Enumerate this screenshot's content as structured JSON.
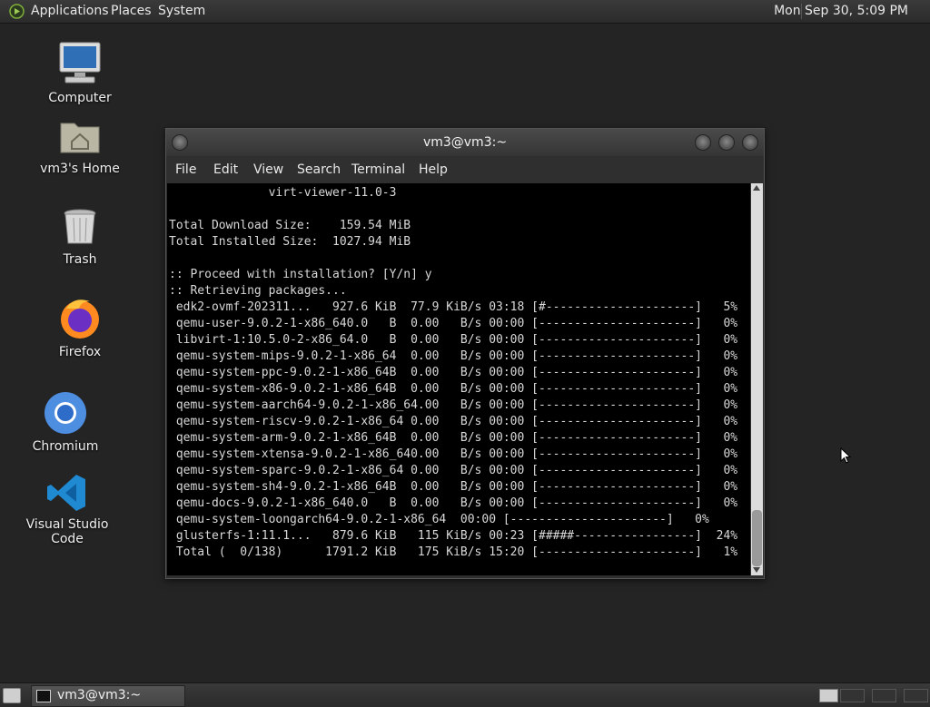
{
  "top_panel": {
    "applications": "Applications",
    "places": "Places",
    "system": "System",
    "clock": "Mon Sep 30,  5:09 PM"
  },
  "desktop": {
    "icons": [
      {
        "label": "Computer",
        "icon": "computer-icon"
      },
      {
        "label": "vm3's Home",
        "icon": "home-folder-icon"
      },
      {
        "label": "Trash",
        "icon": "trash-icon"
      },
      {
        "label": "Firefox",
        "icon": "firefox-icon"
      },
      {
        "label": "Chromium",
        "icon": "chromium-icon"
      },
      {
        "label": "Visual Studio Code",
        "icon": "vscode-icon"
      }
    ]
  },
  "terminal": {
    "title": "vm3@vm3:~",
    "menu": [
      "File",
      "Edit",
      "View",
      "Search",
      "Terminal",
      "Help"
    ],
    "lines": [
      "              virt-viewer-11.0-3",
      "",
      "Total Download Size:    159.54 MiB",
      "Total Installed Size:  1027.94 MiB",
      "",
      ":: Proceed with installation? [Y/n] y",
      ":: Retrieving packages...",
      " edk2-ovmf-202311...   927.6 KiB  77.9 KiB/s 03:18 [#---------------------]   5%",
      " qemu-user-9.0.2-1-x86_640.0   B  0.00   B/s 00:00 [----------------------]   0%",
      " libvirt-1:10.5.0-2-x86_64.0   B  0.00   B/s 00:00 [----------------------]   0%",
      " qemu-system-mips-9.0.2-1-x86_64  0.00   B/s 00:00 [----------------------]   0%",
      " qemu-system-ppc-9.0.2-1-x86_64B  0.00   B/s 00:00 [----------------------]   0%",
      " qemu-system-x86-9.0.2-1-x86_64B  0.00   B/s 00:00 [----------------------]   0%",
      " qemu-system-aarch64-9.0.2-1-x86_64.00   B/s 00:00 [----------------------]   0%",
      " qemu-system-riscv-9.0.2-1-x86_64 0.00   B/s 00:00 [----------------------]   0%",
      " qemu-system-arm-9.0.2-1-x86_64B  0.00   B/s 00:00 [----------------------]   0%",
      " qemu-system-xtensa-9.0.2-1-x86_640.00   B/s 00:00 [----------------------]   0%",
      " qemu-system-sparc-9.0.2-1-x86_64 0.00   B/s 00:00 [----------------------]   0%",
      " qemu-system-sh4-9.0.2-1-x86_64B  0.00   B/s 00:00 [----------------------]   0%",
      " qemu-docs-9.0.2-1-x86_640.0   B  0.00   B/s 00:00 [----------------------]   0%",
      " qemu-system-loongarch64-9.0.2-1-x86_64  00:00 [----------------------]   0%",
      " glusterfs-1:11.1...   879.6 KiB   115 KiB/s 00:23 [#####-----------------]  24%",
      " Total (  0/138)      1791.2 KiB   175 KiB/s 15:20 [----------------------]   1%"
    ]
  },
  "taskbar": {
    "window_label": "vm3@vm3:~"
  }
}
